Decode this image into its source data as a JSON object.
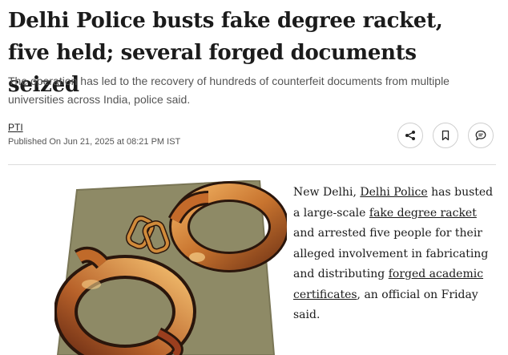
{
  "article": {
    "headline": "Delhi Police busts fake degree racket, five held; several forged documents seized",
    "summary": "The operation has led to the recovery of hundreds of counterfeit documents from multiple universities across India, police said.",
    "author": "PTI",
    "published": "Published On Jun 21, 2025 at 08:21 PM IST",
    "body": {
      "part1": "New Delhi, ",
      "link1": "Delhi Police",
      "part2": " has busted a large-scale ",
      "link2": "fake degree racket",
      "part3": " and arrested five people for their alleged involvement in fabricating and distributing ",
      "link3": "forged academic certificates",
      "part4": ", an official on Friday said."
    }
  },
  "actions": {
    "share_icon": "share-icon",
    "bookmark_icon": "bookmark-icon",
    "comment_icon": "comment-icon"
  },
  "colors": {
    "headline": "#1b1b1b",
    "summary": "#555555",
    "image_background": "#8e8a66",
    "cuff_metal": "#c8742f"
  }
}
